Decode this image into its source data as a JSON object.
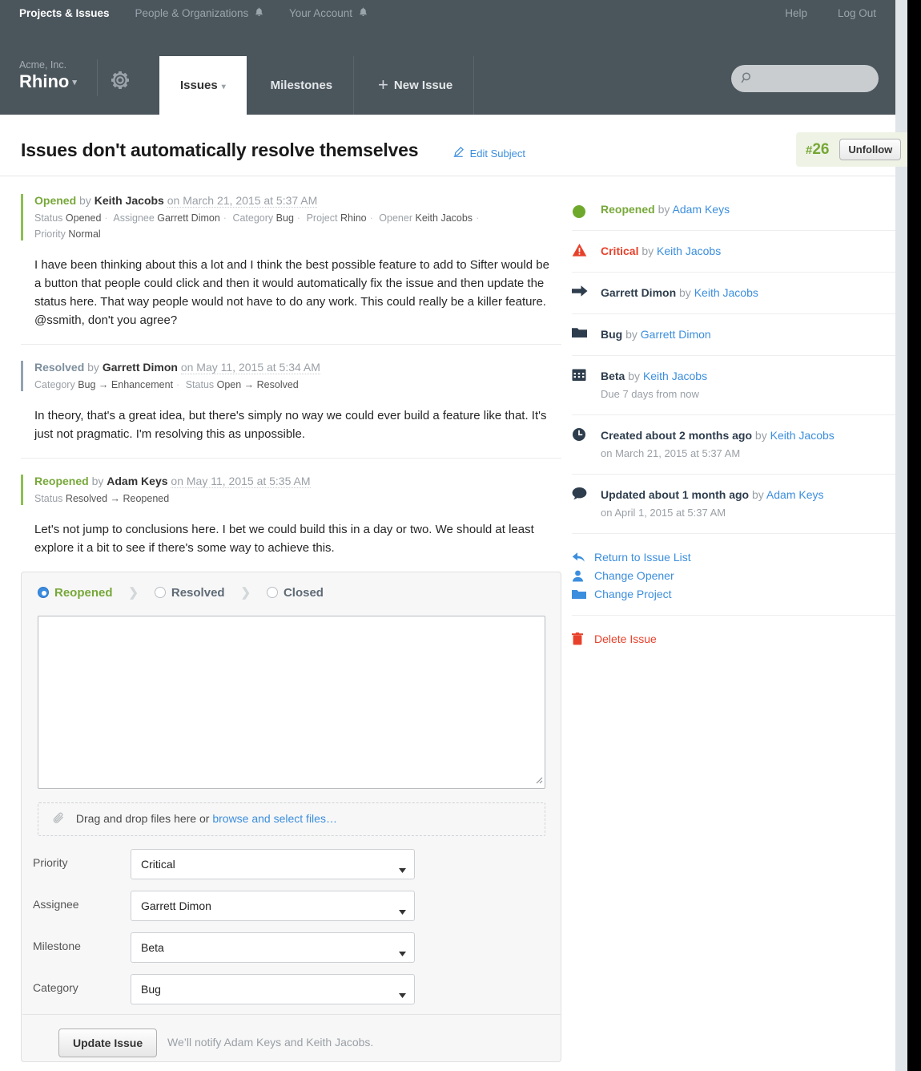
{
  "global_nav": {
    "left_items": [
      {
        "label": "Projects & Issues",
        "active": true,
        "bell": false
      },
      {
        "label": "People & Organizations",
        "active": false,
        "bell": true
      },
      {
        "label": "Your Account",
        "active": false,
        "bell": true
      }
    ],
    "right_items": [
      {
        "label": "Help"
      },
      {
        "label": "Log Out"
      }
    ]
  },
  "project": {
    "org": "Acme, Inc.",
    "name": "Rhino",
    "caret": "▾",
    "gear_icon": "gear-icon"
  },
  "tabs": [
    {
      "label": "Issues",
      "selected": true,
      "caret": "▾"
    },
    {
      "label": "Milestones",
      "selected": false
    },
    {
      "label": "New Issue",
      "selected": false,
      "plus": "+"
    }
  ],
  "search": {
    "placeholder": "",
    "value": "",
    "icon": "search-icon"
  },
  "issue": {
    "title": "Issues don't automatically resolve themselves",
    "edit_subject_label": "Edit Subject",
    "number": "26",
    "number_hash": "#",
    "unfollow_label": "Unfollow"
  },
  "comments": [
    {
      "action": "Opened",
      "action_color": "green",
      "by_label": "by",
      "author": "Keith Jacobs",
      "timestamp": "on March 21, 2015 at 5:37 AM",
      "attributes": [
        {
          "key": "Status",
          "value": "Opened"
        },
        {
          "key": "Assignee",
          "value": "Garrett Dimon"
        },
        {
          "key": "Category",
          "value": "Bug"
        },
        {
          "key": "Project",
          "value": "Rhino"
        },
        {
          "key": "Opener",
          "value": "Keith Jacobs"
        },
        {
          "key": "Priority",
          "value": "Normal"
        }
      ],
      "body": "I have been thinking about this a lot and I think the best possible feature to add to Sifter would be a button that people could click and then it would automatically fix the issue and then update the status here. That way people would not have to do any work. This could really be a killer feature. @ssmith, don't you agree?"
    },
    {
      "action": "Resolved",
      "action_color": "blue",
      "by_label": "by",
      "author": "Garrett Dimon",
      "timestamp": "on May 11, 2015 at 5:34 AM",
      "attributes": [
        {
          "key": "Category",
          "value": "Bug → Enhancement"
        },
        {
          "key": "Status",
          "value": "Open → Resolved"
        }
      ],
      "body": "In theory, that's a great idea, but there's simply no way we could ever build a feature like that. It's just not pragmatic. I'm resolving this as unpossible."
    },
    {
      "action": "Reopened",
      "action_color": "green",
      "by_label": "by",
      "author": "Adam Keys",
      "timestamp": "on May 11, 2015 at 5:35 AM",
      "attributes": [
        {
          "key": "Status",
          "value": "Resolved → Reopened"
        }
      ],
      "body": "Let's not jump to conclusions here. I bet we could build this in a day or two. We should at least explore it a bit to see if there's some way to achieve this."
    }
  ],
  "update_form": {
    "status_options": [
      {
        "label": "Reopened",
        "selected": true
      },
      {
        "label": "Resolved",
        "selected": false
      },
      {
        "label": "Closed",
        "selected": false
      }
    ],
    "status_separator": "❯",
    "comment_value": "",
    "comment_placeholder": "",
    "dropzone_text": "Drag and drop files here or ",
    "dropzone_link": "browse and select files…",
    "dropzone_icon": "paperclip-icon",
    "fields": [
      {
        "label": "Priority",
        "value": "Critical"
      },
      {
        "label": "Assignee",
        "value": "Garrett Dimon"
      },
      {
        "label": "Milestone",
        "value": "Beta"
      },
      {
        "label": "Category",
        "value": "Bug"
      }
    ],
    "submit_label": "Update Issue",
    "notify_text": "We’ll notify Adam Keys and Keith Jacobs."
  },
  "activity": [
    {
      "icon": "status-circle-icon",
      "title": "Reopened",
      "title_color": "green",
      "by_label": "by",
      "actor": "Adam Keys",
      "sub": ""
    },
    {
      "icon": "warning-triangle-icon",
      "title": "Critical",
      "title_color": "red",
      "by_label": "by",
      "actor": "Keith Jacobs",
      "sub": ""
    },
    {
      "icon": "arrow-right-icon",
      "title": "Garrett Dimon",
      "title_color": "dark",
      "by_label": "by",
      "actor": "Keith Jacobs",
      "sub": ""
    },
    {
      "icon": "folder-icon",
      "title": "Bug",
      "title_color": "dark",
      "by_label": "by",
      "actor": "Garrett Dimon",
      "sub": ""
    },
    {
      "icon": "calendar-icon",
      "title": "Beta",
      "title_color": "dark",
      "by_label": "by",
      "actor": "Keith Jacobs",
      "sub": "Due 7 days from now"
    },
    {
      "icon": "clock-icon",
      "title": "Created about 2 months ago",
      "title_color": "dark",
      "by_label": "by",
      "actor": "Keith Jacobs",
      "sub": "on March 21, 2015 at 5:37 AM"
    },
    {
      "icon": "comment-bubble-icon",
      "title": "Updated about 1 month ago",
      "title_color": "dark",
      "by_label": "by",
      "actor": "Adam Keys",
      "sub": "on April 1, 2015 at 5:37 AM"
    }
  ],
  "side_actions": [
    {
      "label": "Return to Issue List",
      "icon": "back-arrow-icon"
    },
    {
      "label": "Change Opener",
      "icon": "person-icon"
    },
    {
      "label": "Change Project",
      "icon": "folder-icon"
    }
  ],
  "danger_action": {
    "label": "Delete Issue",
    "icon": "trash-icon"
  },
  "colors": {
    "topbar": "#4b555c",
    "green": "#77a839",
    "link_blue": "#3b8ede",
    "red": "#e8412b",
    "dark_slate": "#2e3d4d",
    "muted": "#9aa0a6",
    "badge_bg": "#eef3e6"
  }
}
